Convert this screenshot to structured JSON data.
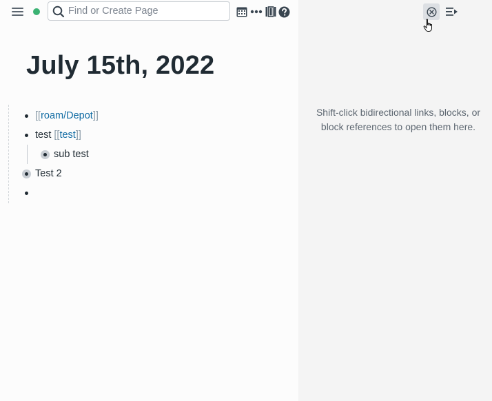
{
  "topbar": {
    "menu_icon": "hamburger-menu-icon",
    "status_icon": "sync-status-dot",
    "status_color": "#3bb273",
    "search_placeholder": "Find or Create Page",
    "search_icon": "search-icon",
    "calendar_icon": "calendar-icon",
    "more_icon": "ellipsis-icon",
    "columns_icon": "columns-icon",
    "help_icon": "help-circle-icon"
  },
  "page": {
    "title": "July 15th, 2022",
    "blocks": [
      {
        "open_bracket": "[[",
        "link_text": "roam/Depot",
        "close_bracket": "]]"
      },
      {
        "prefix": "test ",
        "open_bracket": "[[",
        "link_text": "test",
        "close_bracket": "]]"
      },
      {
        "text": "sub test"
      },
      {
        "text": "Test 2"
      },
      {
        "text": ""
      }
    ]
  },
  "sidebar": {
    "close_icon": "close-circle-icon",
    "collapse_icon": "collapse-sidebar-icon",
    "hint": "Shift-click bidirectional links, blocks, or block references to open them here."
  },
  "colors": {
    "link": "#106ba3",
    "bracket": "#8a9ba8",
    "sidebar_bg": "#f4f4f4",
    "main_bg": "#fcfcfc"
  }
}
